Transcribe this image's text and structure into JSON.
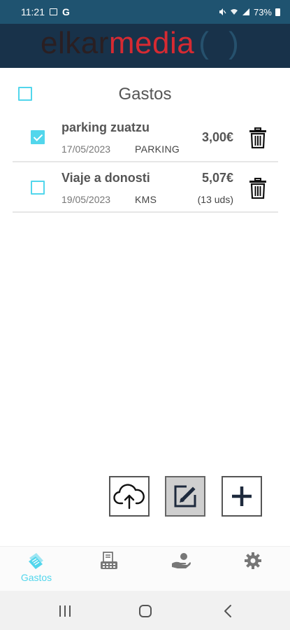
{
  "status_bar": {
    "time": "11:21",
    "g_indicator": "G",
    "battery": "73%"
  },
  "header": {
    "logo_part1": "elkar",
    "logo_part2": "media",
    "logo_part3": "( )"
  },
  "page": {
    "title": "Gastos",
    "select_all_checked": false
  },
  "expenses": [
    {
      "title": "parking zuatzu",
      "date": "17/05/2023",
      "category": "PARKING",
      "amount": "3,00€",
      "units": "",
      "checked": true
    },
    {
      "title": "Viaje a donosti",
      "date": "19/05/2023",
      "category": "KMS",
      "amount": "5,07€",
      "units": "(13 uds)",
      "checked": false
    }
  ],
  "actions": {
    "upload_icon": "cloud-upload-icon",
    "edit_icon": "edit-icon",
    "add_icon": "plus-icon"
  },
  "bottom_nav": {
    "items": [
      {
        "label": "Gastos",
        "icon": "receipts-icon",
        "active": true
      },
      {
        "label": "",
        "icon": "calculator-icon",
        "active": false
      },
      {
        "label": "",
        "icon": "hand-coin-icon",
        "active": false
      },
      {
        "label": "",
        "icon": "gear-icon",
        "active": false
      }
    ]
  },
  "colors": {
    "accent": "#52d6ec",
    "header_bg": "#18324a",
    "status_bar_bg": "#1f5370",
    "logo_red": "#d62a32"
  }
}
